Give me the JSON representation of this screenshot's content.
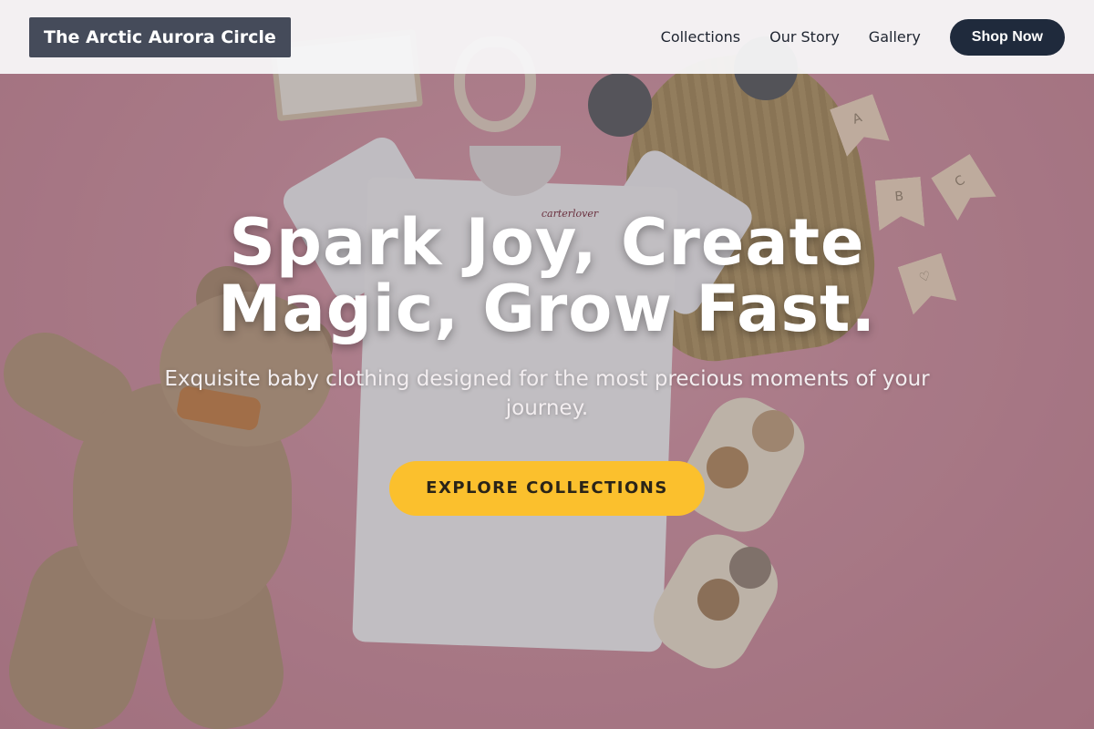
{
  "header": {
    "logo_text": "The Arctic Aurora Circle",
    "nav": [
      {
        "label": "Collections"
      },
      {
        "label": "Our Story"
      },
      {
        "label": "Gallery"
      }
    ],
    "shop_button": "Shop Now"
  },
  "hero": {
    "headline": "Spark Joy, Create Magic, Grow Fast.",
    "subtitle": "Exquisite baby clothing designed for the most precious moments of your journey.",
    "cta_label": "EXPLORE COLLECTIONS",
    "background_image": {
      "tshirt_tag_text": "carterlover",
      "flag_letters": [
        "A",
        "B",
        "C",
        "♡"
      ]
    }
  },
  "colors": {
    "navbar_bg": "#f8f8f9",
    "logo_bg": "#454b5a",
    "shop_button_bg": "#1f2a3c",
    "cta_bg": "#fbc02d",
    "hero_background": "#d495a4"
  }
}
